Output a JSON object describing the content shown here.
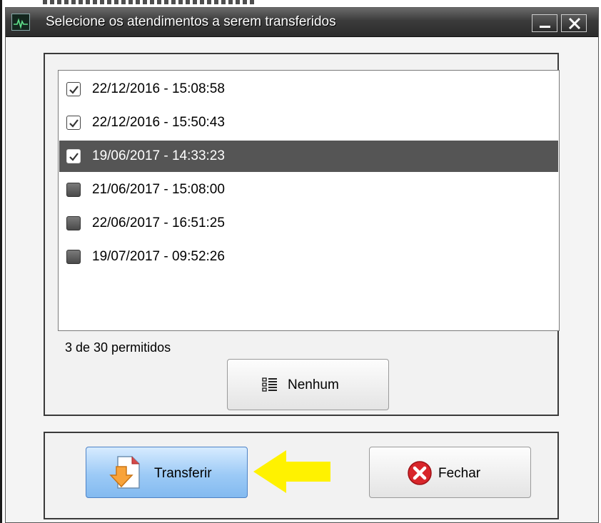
{
  "window": {
    "title": "Selecione os atendimentos a serem transferidos"
  },
  "list": {
    "items": [
      {
        "label": "22/12/2016 - 15:08:58",
        "checked": true,
        "selected": false
      },
      {
        "label": "22/12/2016 - 15:50:43",
        "checked": true,
        "selected": false
      },
      {
        "label": "19/06/2017 - 14:33:23",
        "checked": true,
        "selected": true
      },
      {
        "label": "21/06/2017 - 15:08:00",
        "checked": false,
        "selected": false
      },
      {
        "label": "22/06/2017 - 16:51:25",
        "checked": false,
        "selected": false
      },
      {
        "label": "19/07/2017 - 09:52:26",
        "checked": false,
        "selected": false
      }
    ]
  },
  "counter": {
    "text": "3 de 30 permitidos"
  },
  "buttons": {
    "nenhum_label": "Nenhum",
    "transferir_label": "Transferir",
    "fechar_label": "Fechar"
  },
  "icons": {
    "app": "app-monitor-icon",
    "minimize": "minimize-icon",
    "close": "close-icon",
    "nenhum": "list-select-none-icon",
    "transferir": "document-download-icon",
    "fechar": "red-x-circle-icon",
    "annotation": "yellow-arrow-icon"
  },
  "colors": {
    "titlebar": "#3b3b3b",
    "selected_row": "#555555",
    "transferir_button": "#9ccaf6",
    "fechar_icon": "#d8262b",
    "annotation_arrow": "#fff200"
  }
}
